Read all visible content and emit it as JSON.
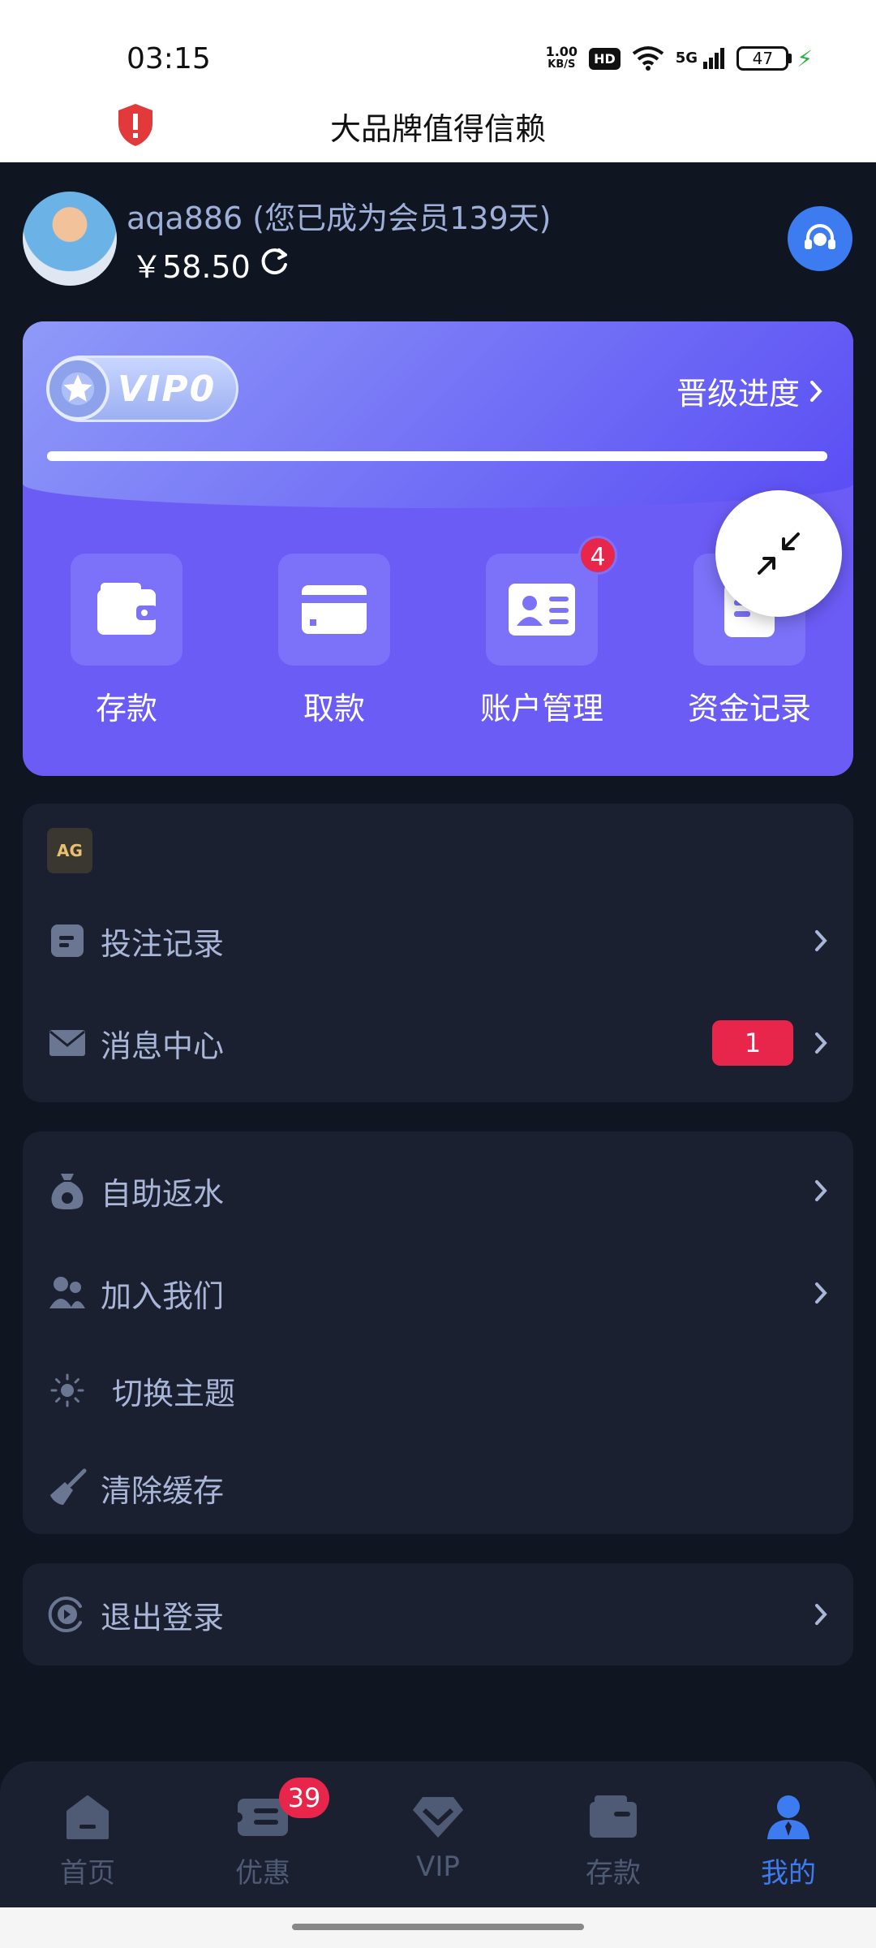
{
  "status_bar": {
    "time": "03:15",
    "net_speed_value": "1.00",
    "net_speed_unit": "KB/S",
    "hd": "HD",
    "signal": "5G",
    "battery": "47"
  },
  "header": {
    "title": "大品牌值得信赖"
  },
  "user": {
    "username": "aqa886 (您已成为会员139天)",
    "balance": "￥58.50"
  },
  "vip": {
    "level": "VIP0",
    "progress_label": "晋级进度",
    "progress_fraction": 1.0,
    "actions": [
      {
        "label": "存款",
        "icon": "wallet-icon"
      },
      {
        "label": "取款",
        "icon": "card-icon"
      },
      {
        "label": "账户管理",
        "icon": "id-card-icon",
        "badge": "4"
      },
      {
        "label": "资金记录",
        "icon": "record-icon"
      }
    ]
  },
  "menu_group1": {
    "logo_text": "AG",
    "items": [
      {
        "label": "投注记录",
        "icon": "bet-record-icon"
      },
      {
        "label": "消息中心",
        "icon": "mail-icon",
        "badge": "1"
      }
    ]
  },
  "menu_group2": {
    "items": [
      {
        "label": "自助返水",
        "icon": "money-bag-icon"
      },
      {
        "label": "加入我们",
        "icon": "users-icon"
      },
      {
        "label": "切换主题",
        "icon": "sun-icon"
      },
      {
        "label": "清除缓存",
        "icon": "broom-icon"
      }
    ]
  },
  "menu_group3": {
    "items": [
      {
        "label": "退出登录",
        "icon": "logout-icon"
      }
    ]
  },
  "bottom_nav": {
    "items": [
      {
        "label": "首页",
        "icon": "home-icon"
      },
      {
        "label": "优惠",
        "icon": "ticket-icon",
        "badge": "39"
      },
      {
        "label": "VIP",
        "icon": "diamond-icon"
      },
      {
        "label": "存款",
        "icon": "wallet-icon"
      },
      {
        "label": "我的",
        "icon": "user-icon",
        "active": true
      }
    ]
  },
  "colors": {
    "background": "#101522",
    "panel": "#1b2030",
    "accent": "#3c7cf0",
    "vip_purple": "#6c5cf6",
    "badge_red": "#e8254a"
  }
}
